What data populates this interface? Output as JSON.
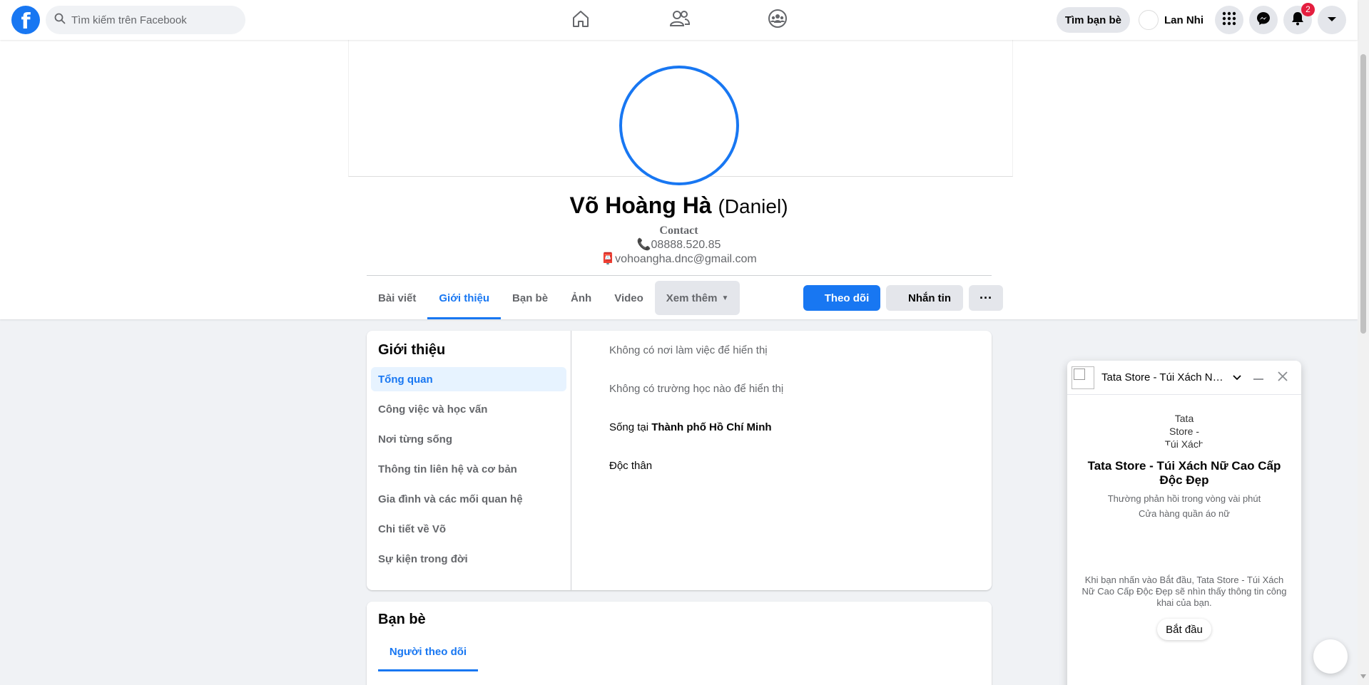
{
  "topnav": {
    "logo_letter": "f",
    "search_placeholder": "Tìm kiếm trên Facebook",
    "tabs": [
      {
        "icon": "home-icon"
      },
      {
        "icon": "friends-icon"
      },
      {
        "icon": "groups-icon"
      }
    ],
    "find_friends": "Tìm bạn bè",
    "user_name": "Lan Nhi",
    "notifications_count": "2"
  },
  "profile": {
    "name": "Võ Hoàng Hà",
    "alt_name": "(Daniel)",
    "bio_title": "Contact",
    "phone": "📞08888.520.85",
    "email": "📮vohoangha.dnc@gmail.com"
  },
  "profile_tabs": [
    "Bài viết",
    "Giới thiệu",
    "Bạn bè",
    "Ảnh",
    "Video",
    "Xem thêm"
  ],
  "actions": {
    "follow": "Theo dõi",
    "message": "Nhắn tin",
    "more": "···"
  },
  "intro": {
    "title": "Giới thiệu",
    "menu": [
      "Tổng quan",
      "Công việc và học vấn",
      "Nơi từng sống",
      "Thông tin liên hệ và cơ bản",
      "Gia đình và các mối quan hệ",
      "Chi tiết về Võ",
      "Sự kiện trong đời"
    ],
    "facts": {
      "work": "Không có nơi làm việc để hiển thị",
      "school": "Không có trường học nào để hiển thị",
      "lives_prefix": "Sống tại ",
      "lives_city": "Thành phố Hồ Chí Minh",
      "relationship": "Độc thân"
    }
  },
  "friends": {
    "title": "Bạn bè",
    "tab": "Người theo dõi"
  },
  "chat": {
    "header_name": "Tata Store - Túi Xách Nữ Cao Cấp Độc Đẹp",
    "avatar_alt": "Tata Store - Túi Xách",
    "title": "Tata Store - Túi Xách Nữ Cao Cấp Độc Đẹp",
    "response": "Thường phản hồi trong vòng vài phút",
    "category": "Cửa hàng quần áo nữ",
    "note": "Khi bạn nhấn vào Bắt đầu, Tata Store - Túi Xách Nữ Cao Cấp Độc Đẹp sẽ nhìn thấy thông tin công khai của bạn.",
    "start": "Bắt đầu"
  },
  "colors": {
    "brand": "#1877f2",
    "badge": "#e41e3f",
    "background": "#f0f2f5"
  }
}
